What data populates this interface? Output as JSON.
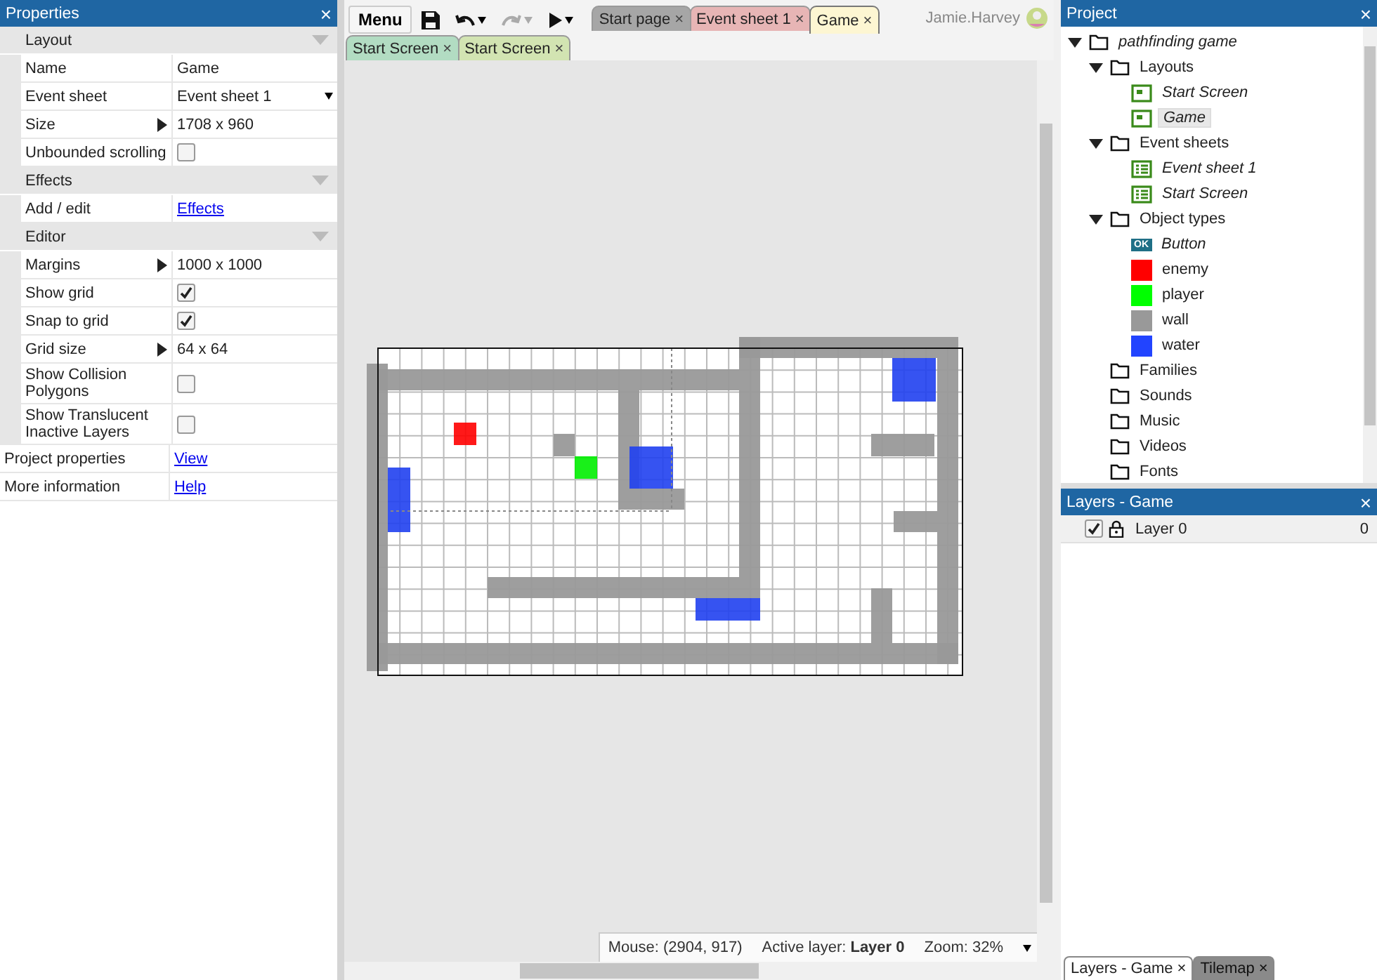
{
  "properties": {
    "title": "Properties",
    "close": "×",
    "sections": [
      {
        "title": "Layout",
        "expanded": true,
        "rows": [
          {
            "label": "Name",
            "kind": "text",
            "value": "Game"
          },
          {
            "label": "Event sheet",
            "kind": "dropdown",
            "value": "Event sheet 1"
          },
          {
            "label": "Size",
            "kind": "expand",
            "value": "1708 x 960"
          },
          {
            "label": "Unbounded scrolling",
            "kind": "checkbox",
            "checked": false
          }
        ]
      },
      {
        "title": "Effects",
        "expanded": true,
        "rows": [
          {
            "label": "Add / edit",
            "kind": "link",
            "value": "Effects"
          }
        ]
      },
      {
        "title": "Editor",
        "expanded": true,
        "rows": [
          {
            "label": "Margins",
            "kind": "expand",
            "value": "1000 x 1000"
          },
          {
            "label": "Show grid",
            "kind": "checkbox",
            "checked": true
          },
          {
            "label": "Snap to grid",
            "kind": "checkbox",
            "checked": true
          },
          {
            "label": "Grid size",
            "kind": "expand",
            "value": "64 x 64"
          },
          {
            "label": "Show Collision Polygons",
            "kind": "checkbox",
            "checked": false
          },
          {
            "label": "Show Translucent Inactive Layers",
            "kind": "checkbox",
            "checked": false
          }
        ]
      }
    ],
    "footer_rows": [
      {
        "label": "Project properties",
        "value": "View"
      },
      {
        "label": "More information",
        "value": "Help"
      }
    ]
  },
  "toolbar": {
    "menu": "Menu",
    "tools": [
      {
        "kind": "save",
        "disabled": false,
        "dropdown": false
      },
      {
        "kind": "undo",
        "disabled": false,
        "dropdown": true
      },
      {
        "kind": "redo",
        "disabled": true,
        "dropdown": true
      },
      {
        "kind": "run",
        "disabled": false,
        "dropdown": true
      }
    ],
    "user": "Jamie.Harvey"
  },
  "doc_tabs": [
    {
      "label": "Start page",
      "close": "×",
      "color": "#a6a6a6",
      "selected": false
    },
    {
      "label": "Event sheet 1",
      "close": "×",
      "color": "#e7b5b5",
      "selected": false
    },
    {
      "label": "Game",
      "close": "×",
      "color": "#fdf6d2",
      "selected": true
    }
  ],
  "sub_tabs": [
    {
      "label": "Start Screen",
      "close": "×",
      "color": "#b2dcc2",
      "selected": false
    },
    {
      "label": "Start Screen",
      "close": "×",
      "color": "#d2e4b2",
      "selected": false
    }
  ],
  "status_bar": {
    "mouse": "Mouse: (2904, 917)",
    "active_layer": "Active layer: **Layer 0**",
    "zoom": "Zoom: 32%"
  },
  "project": {
    "title": "Project",
    "close": "×",
    "tree": [
      {
        "label": "pathfinding game",
        "kind": "project",
        "expanded": true,
        "selected": false,
        "children": [
          {
            "label": "Layouts",
            "kind": "folder",
            "expanded": true,
            "selected": false,
            "children": [
              {
                "label": "Start Screen",
                "kind": "layout",
                "selected": false
              },
              {
                "label": "Game",
                "kind": "layout",
                "selected": true
              }
            ]
          },
          {
            "label": "Event sheets",
            "kind": "folder",
            "expanded": true,
            "selected": false,
            "children": [
              {
                "label": "Event sheet 1",
                "kind": "eventsheet",
                "selected": false
              },
              {
                "label": "Start Screen",
                "kind": "eventsheet",
                "selected": false
              }
            ]
          },
          {
            "label": "Object types",
            "kind": "folder",
            "expanded": true,
            "selected": false,
            "children": [
              {
                "label": "Button",
                "kind": "button",
                "badge": "OK",
                "selected": false
              },
              {
                "label": "enemy",
                "kind": "sprite",
                "color": "#ff0000",
                "selected": false
              },
              {
                "label": "player",
                "kind": "sprite",
                "color": "#00ff00",
                "selected": false
              },
              {
                "label": "wall",
                "kind": "sprite",
                "color": "#999999",
                "selected": false
              },
              {
                "label": "water",
                "kind": "sprite",
                "color": "#2244ff",
                "selected": false
              }
            ]
          },
          {
            "label": "Families",
            "kind": "folder",
            "selected": false
          },
          {
            "label": "Sounds",
            "kind": "folder",
            "selected": false
          },
          {
            "label": "Music",
            "kind": "folder",
            "selected": false
          },
          {
            "label": "Videos",
            "kind": "folder",
            "selected": false
          },
          {
            "label": "Fonts",
            "kind": "folder",
            "selected": false
          }
        ]
      }
    ]
  },
  "layers": {
    "title": "Layers - Game",
    "close": "×",
    "rows": [
      {
        "name": "Layer 0",
        "visible": true,
        "count": "0"
      }
    ]
  },
  "bottom_tabs": [
    {
      "label": "Layers - Game",
      "close": "×",
      "selected": true
    },
    {
      "label": "Tilemap",
      "close": "×",
      "selected": false
    }
  ]
}
